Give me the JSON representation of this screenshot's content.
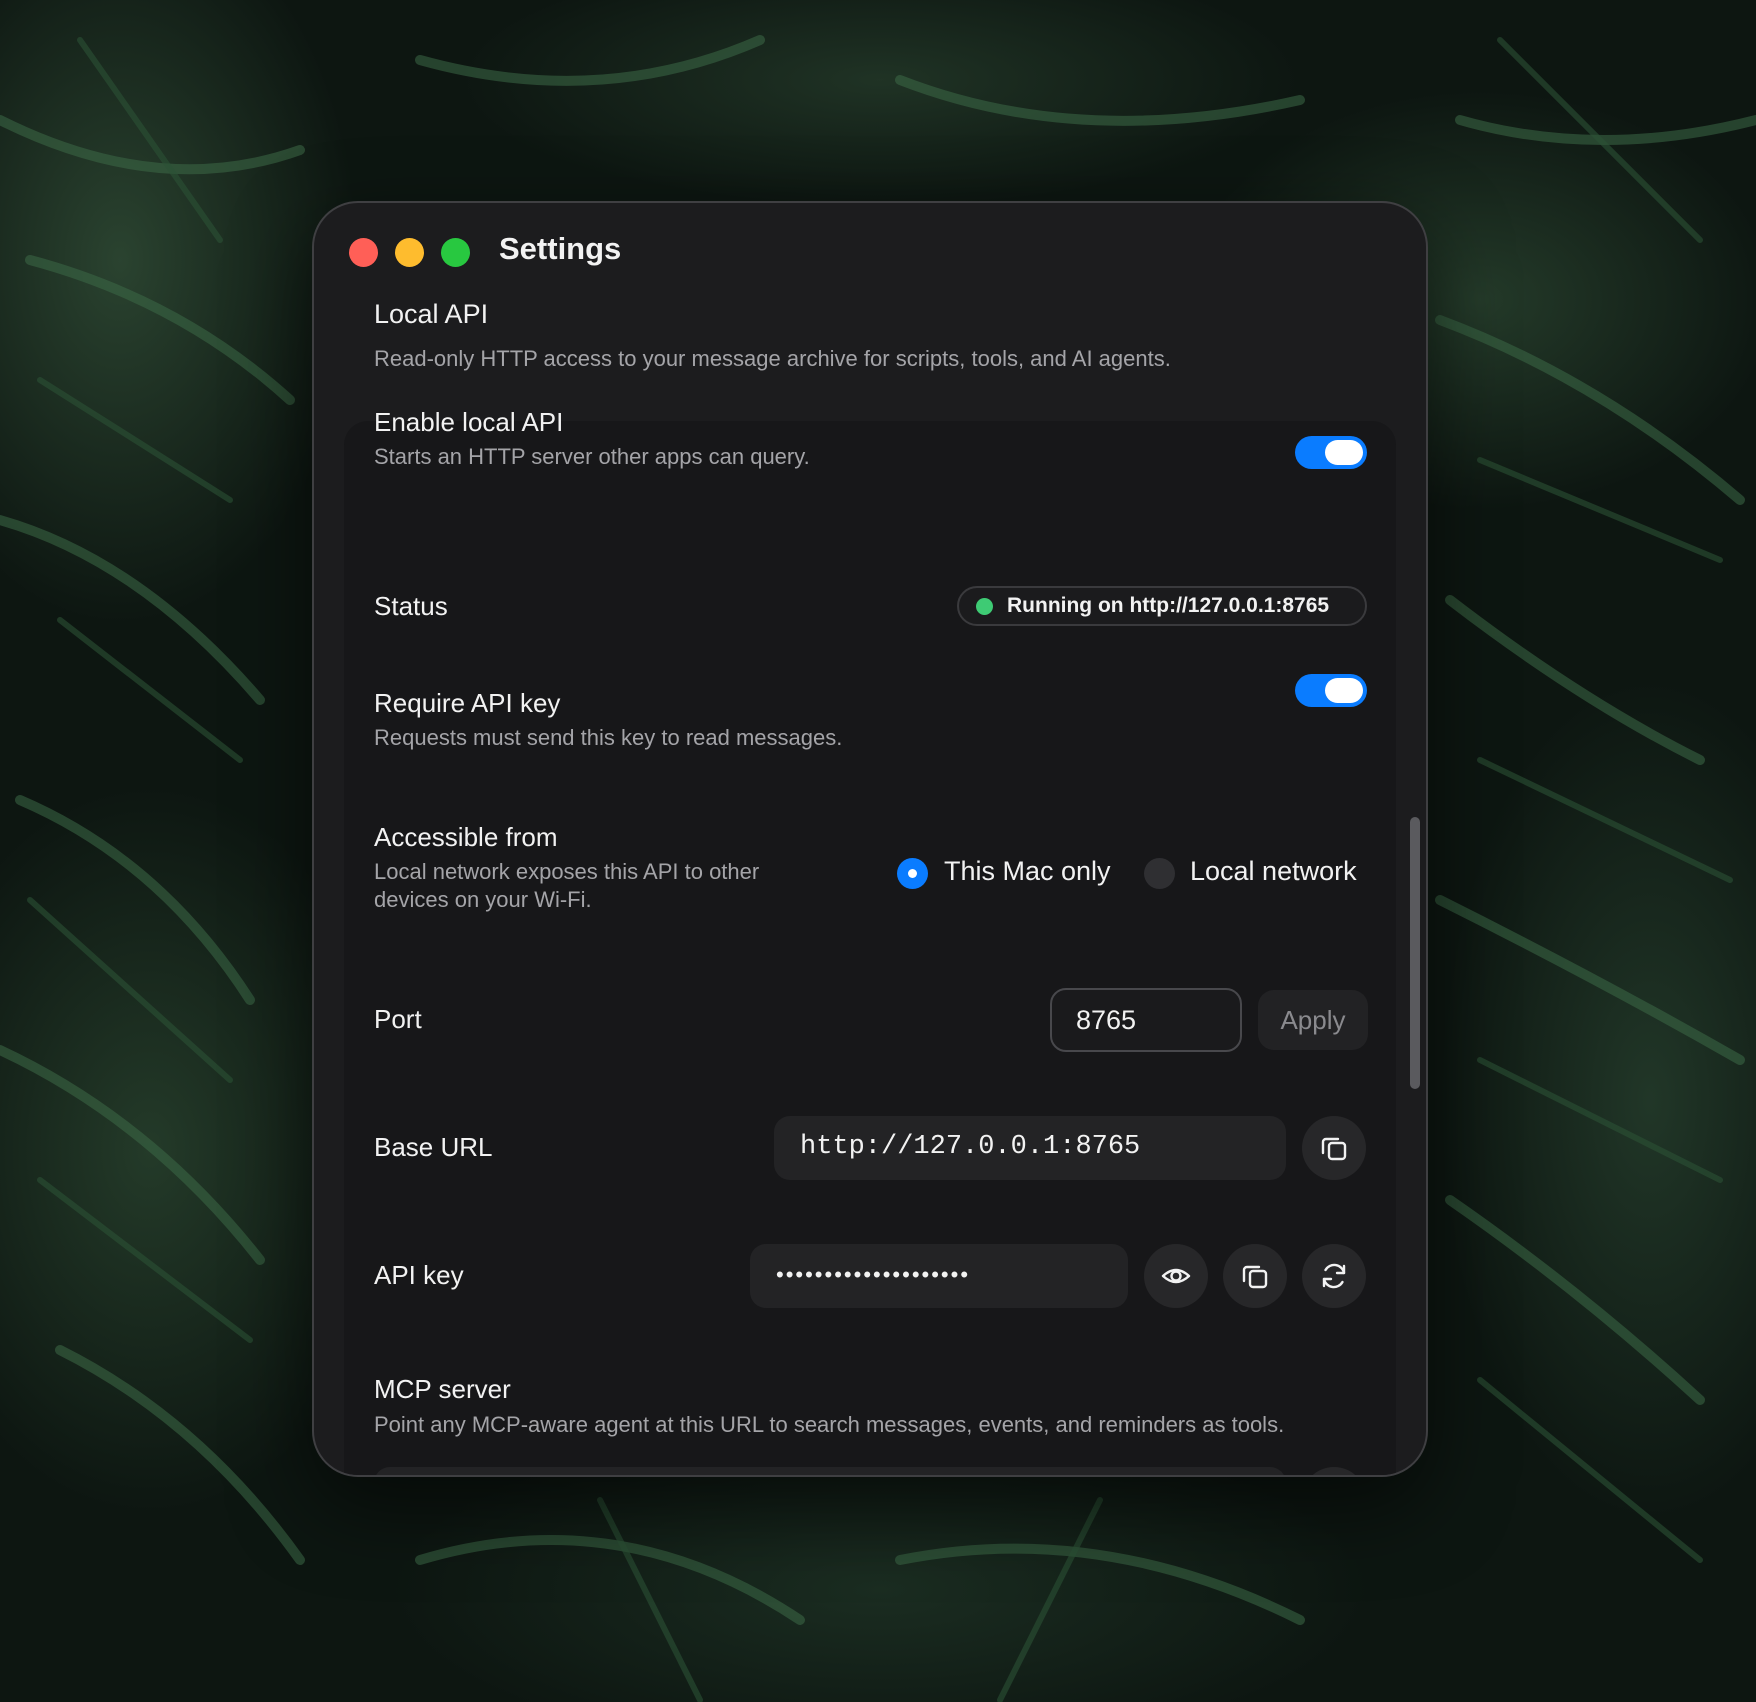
{
  "window": {
    "title": "Settings",
    "controls": [
      "close",
      "minimize",
      "zoom"
    ]
  },
  "section": {
    "title": "Local API",
    "description": "Read-only HTTP access to your message archive for scripts, tools, and AI agents."
  },
  "enable_api": {
    "label": "Enable local API",
    "description": "Starts an HTTP server other apps can query.",
    "enabled": true
  },
  "status": {
    "label": "Status",
    "text": "Running on http://127.0.0.1:8765",
    "color": "#3ecb74"
  },
  "require_key": {
    "label": "Require API key",
    "description": "Requests must send this key to read messages.",
    "enabled": true
  },
  "accessible_from": {
    "label": "Accessible from",
    "description": "Local network exposes this API to other devices on your Wi-Fi.",
    "options": [
      {
        "label": "This Mac only",
        "selected": true
      },
      {
        "label": "Local network",
        "selected": false
      }
    ]
  },
  "port": {
    "label": "Port",
    "value": "8765",
    "apply_label": "Apply"
  },
  "base_url": {
    "label": "Base URL",
    "value": "http://127.0.0.1:8765",
    "copy_icon": "copy-icon"
  },
  "api_key": {
    "label": "API key",
    "masked_value": "••••••••••••••••••••",
    "reveal_icon": "eye-icon",
    "copy_icon": "copy-icon",
    "regenerate_icon": "refresh-icon"
  },
  "mcp": {
    "label": "MCP server",
    "description": "Point any MCP-aware agent at this URL to search messages, events, and reminders as tools."
  },
  "colors": {
    "accent": "#0a7cff",
    "window_bg": "#1c1c1e",
    "card_bg": "#171719"
  }
}
